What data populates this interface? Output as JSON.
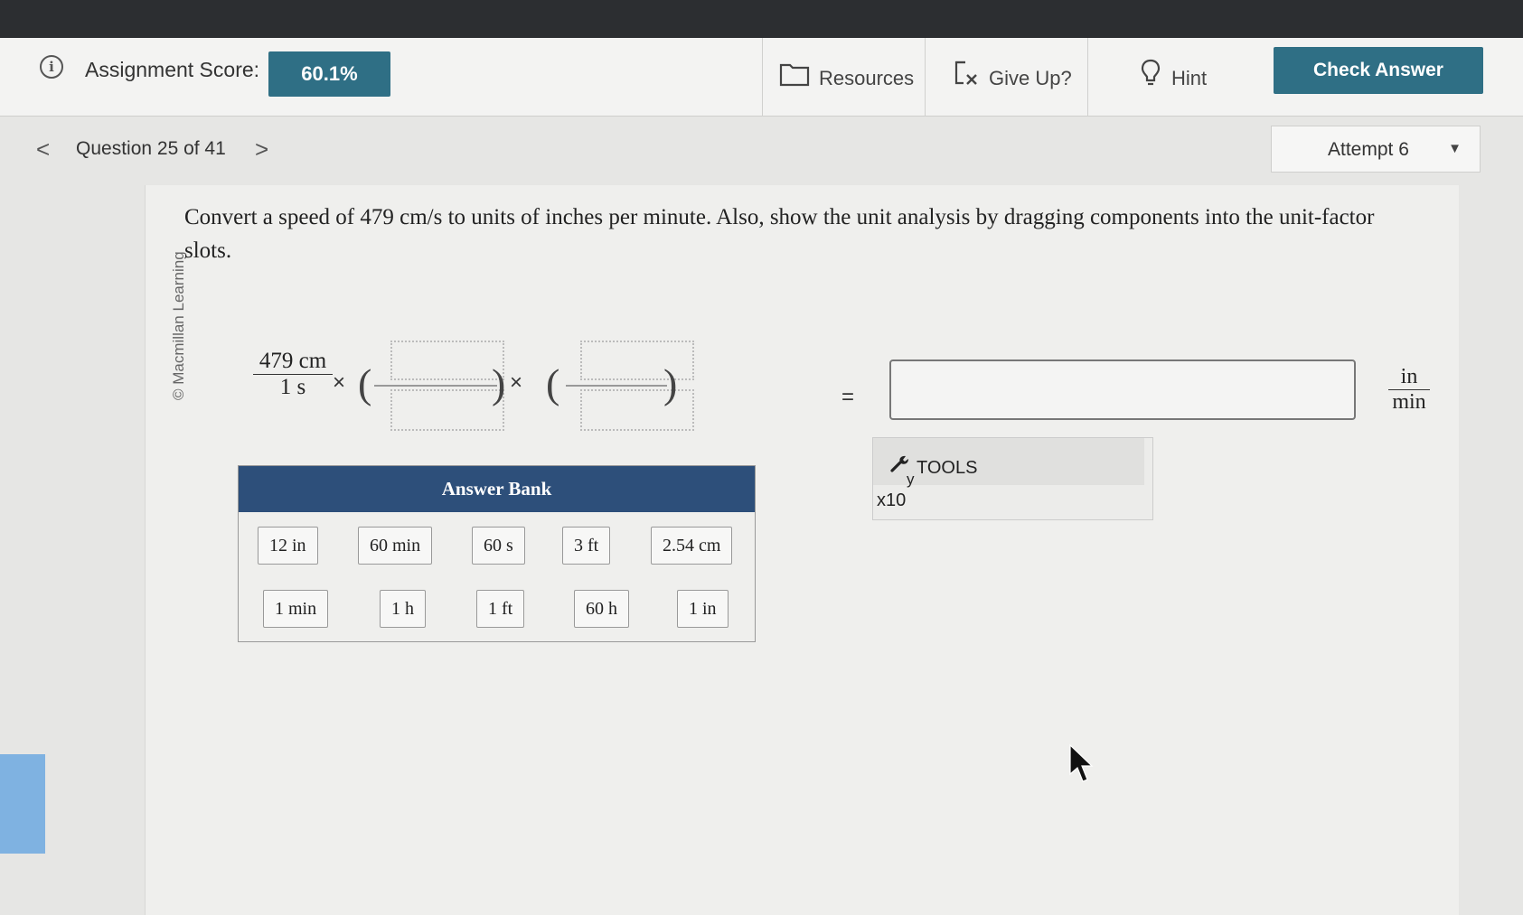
{
  "header": {
    "score_label": "Assignment Score:",
    "score_value": "60.1%",
    "resources_label": "Resources",
    "give_up_label": "Give Up?",
    "hint_label": "Hint",
    "check_answer_label": "Check Answer"
  },
  "nav": {
    "prev_glyph": "<",
    "question_label": "Question 25 of 41",
    "next_glyph": ">",
    "attempt_label": "Attempt 6"
  },
  "copyright": "© Macmillan Learning",
  "question": {
    "text": "Convert a speed of 479 cm/s to units of inches per minute. Also, show the unit analysis by dragging components into the unit-factor slots."
  },
  "equation": {
    "start_numerator": "479 cm",
    "start_denominator": "1 s",
    "times": "×",
    "equals": "=",
    "result_unit_numerator": "in",
    "result_unit_denominator": "min",
    "answer_value": ""
  },
  "answer_bank": {
    "title": "Answer Bank",
    "row1": [
      "12 in",
      "60 min",
      "60 s",
      "3 ft",
      "2.54 cm"
    ],
    "row2": [
      "1 min",
      "1 h",
      "1 ft",
      "60 h",
      "1 in"
    ]
  },
  "tools": {
    "label": "TOOLS",
    "sub": "y",
    "x10_label": "x10"
  },
  "colors": {
    "accent_teal": "#2f6f85",
    "bank_header_navy": "#2d4f7a"
  }
}
